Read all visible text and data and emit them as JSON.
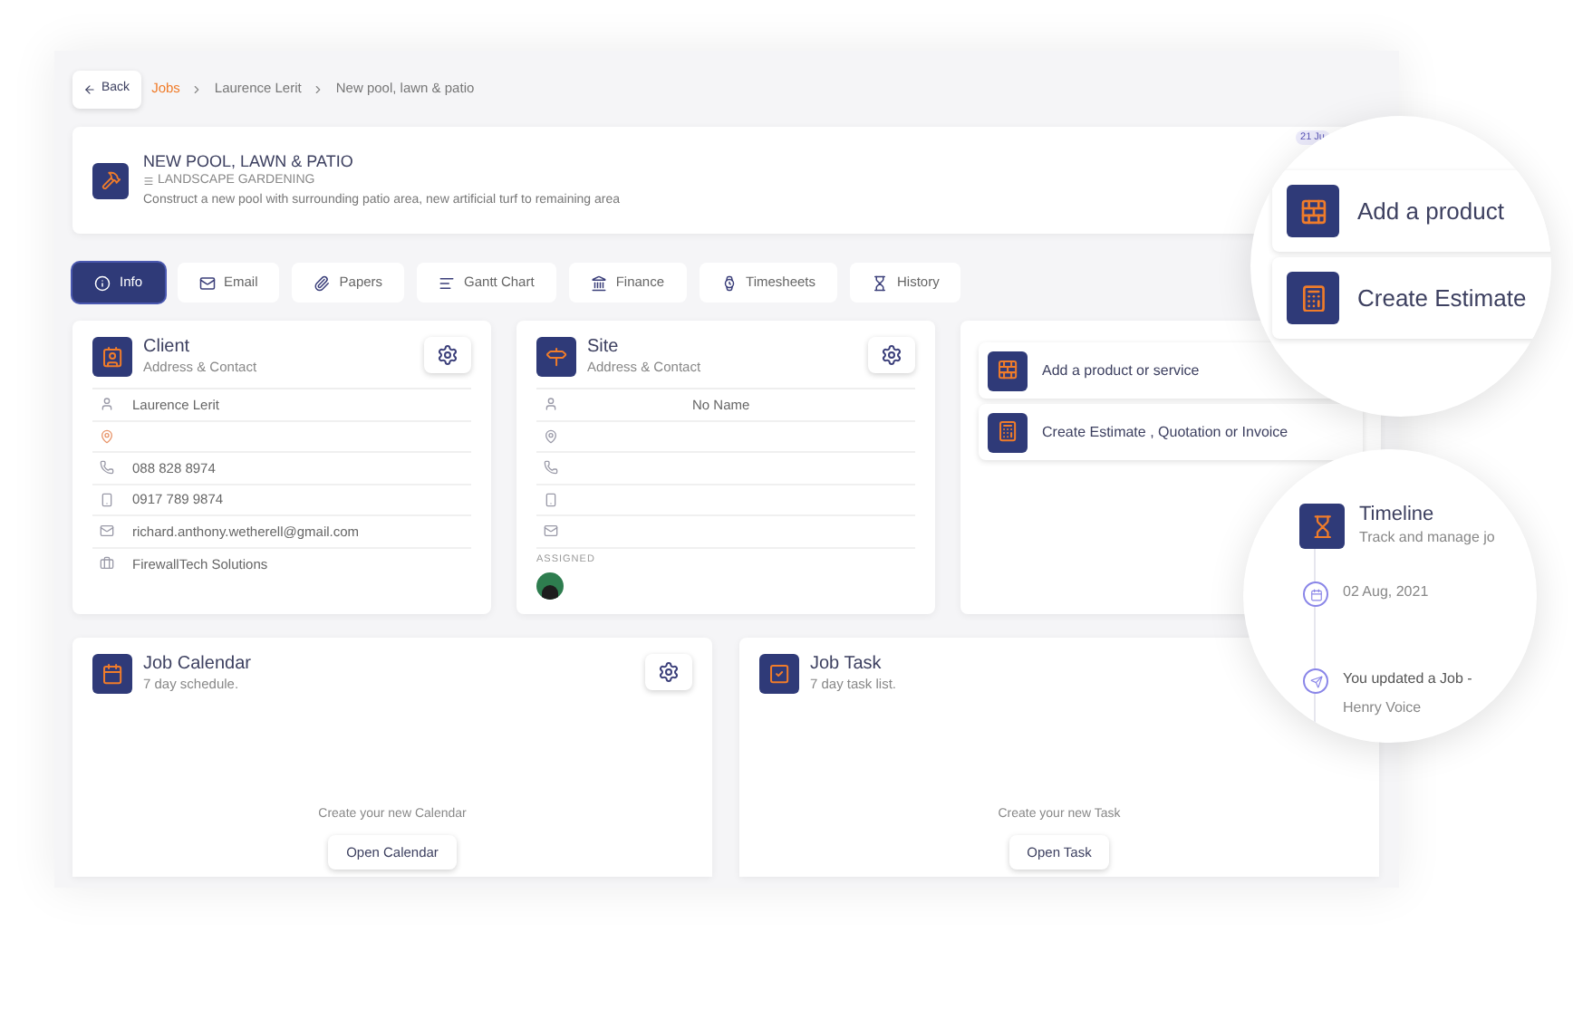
{
  "back_button": "Back",
  "breadcrumb": [
    {
      "label": "Jobs",
      "kind": "link"
    },
    {
      "label": "Laurence Lerit",
      "kind": "text"
    },
    {
      "label": "New pool, lawn & patio",
      "kind": "text"
    }
  ],
  "job": {
    "title": "NEW POOL, LAWN & PATIO",
    "category": "LANDSCAPE GARDENING",
    "description": "Construct a new pool with surrounding patio area, new artificial turf to remaining area",
    "date_badge": "21 Ju"
  },
  "tabs": [
    {
      "label": "Info",
      "selected": true
    },
    {
      "label": "Email",
      "selected": false
    },
    {
      "label": "Papers",
      "selected": false
    },
    {
      "label": "Gantt Chart",
      "selected": false
    },
    {
      "label": "Finance",
      "selected": false
    },
    {
      "label": "Timesheets",
      "selected": false
    },
    {
      "label": "History",
      "selected": false
    }
  ],
  "client": {
    "title": "Client",
    "subtitle": "Address & Contact",
    "rows": [
      {
        "kind": "person",
        "value": "Laurence Lerit",
        "highlighted": false
      },
      {
        "kind": "location",
        "highlighted": true
      },
      {
        "kind": "phone",
        "value": "088 828 8974",
        "highlighted": false
      },
      {
        "kind": "mobile",
        "value": "0917 789 9874",
        "highlighted": false
      },
      {
        "kind": "email",
        "value": "richard.anthony.wetherell@gmail.com",
        "highlighted": false
      },
      {
        "kind": "company",
        "value": "FirewallTech Solutions",
        "highlighted": false
      }
    ]
  },
  "site": {
    "title": "Site",
    "subtitle": "Address & Contact",
    "assigned_label": "ASSIGNED",
    "rows": [
      {
        "kind": "person",
        "value": "No Name",
        "highlighted": false
      },
      {
        "kind": "location",
        "highlighted": false
      },
      {
        "kind": "phone",
        "highlighted": false
      },
      {
        "kind": "mobile",
        "highlighted": false
      },
      {
        "kind": "email",
        "highlighted": false
      }
    ]
  },
  "actions": [
    {
      "label": "Add a product or service",
      "kind": "product"
    },
    {
      "label": "Create Estimate , Quotation or Invoice",
      "kind": "estimate"
    }
  ],
  "calendar": {
    "title": "Job Calendar",
    "subtitle": "7 day schedule.",
    "empty_text": "Create your new Calendar",
    "button": "Open Calendar",
    "has_settings": true
  },
  "task": {
    "title": "Job Task",
    "subtitle": "7 day task list.",
    "empty_text": "Create your new Task",
    "button": "Open Task",
    "has_settings": false
  },
  "zoom_actions": [
    {
      "label": "Add a product",
      "kind": "product"
    },
    {
      "label": "Create Estimate",
      "kind": "estimate"
    }
  ],
  "zoom_timeline": {
    "title": "Timeline",
    "subtitle": "Track and manage jo",
    "events": [
      {
        "kind": "date",
        "text": "02 Aug, 2021"
      },
      {
        "kind": "update",
        "text": "You updated a Job -",
        "author": "Henry Voice"
      }
    ]
  }
}
